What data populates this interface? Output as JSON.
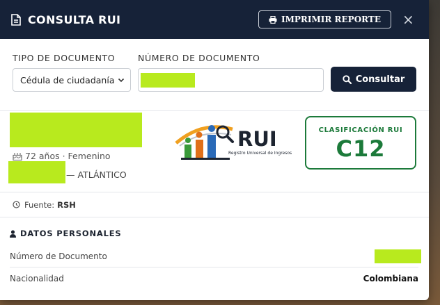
{
  "modal": {
    "title": "CONSULTA RUI",
    "print_label": "IMPRIMIR REPORTE",
    "close_label": "×"
  },
  "form": {
    "doc_type_label": "TIPO DE DOCUMENTO",
    "doc_type_value": "Cédula de ciudadanía",
    "doc_number_label": "NÚMERO DE DOCUMENTO",
    "consult_label": "Consultar"
  },
  "person": {
    "age_gender": "72 años · Femenino",
    "department": "— ATLÁNTICO"
  },
  "logo": {
    "brand": "RUI",
    "subtitle": "Registro Universal de Ingresos"
  },
  "classification": {
    "label": "CLASIFICACIÓN RUI",
    "value": "C12"
  },
  "source": {
    "label": "Fuente:",
    "value": "RSH"
  },
  "personal": {
    "section_title": "DATOS PERSONALES",
    "rows": [
      {
        "label": "Número de Documento",
        "value": ""
      },
      {
        "label": "Nacionalidad",
        "value": "Colombiana"
      }
    ]
  },
  "colors": {
    "header_bg": "#162238",
    "classification_green": "#1c7a3a",
    "redaction": "#b8ea1e"
  }
}
